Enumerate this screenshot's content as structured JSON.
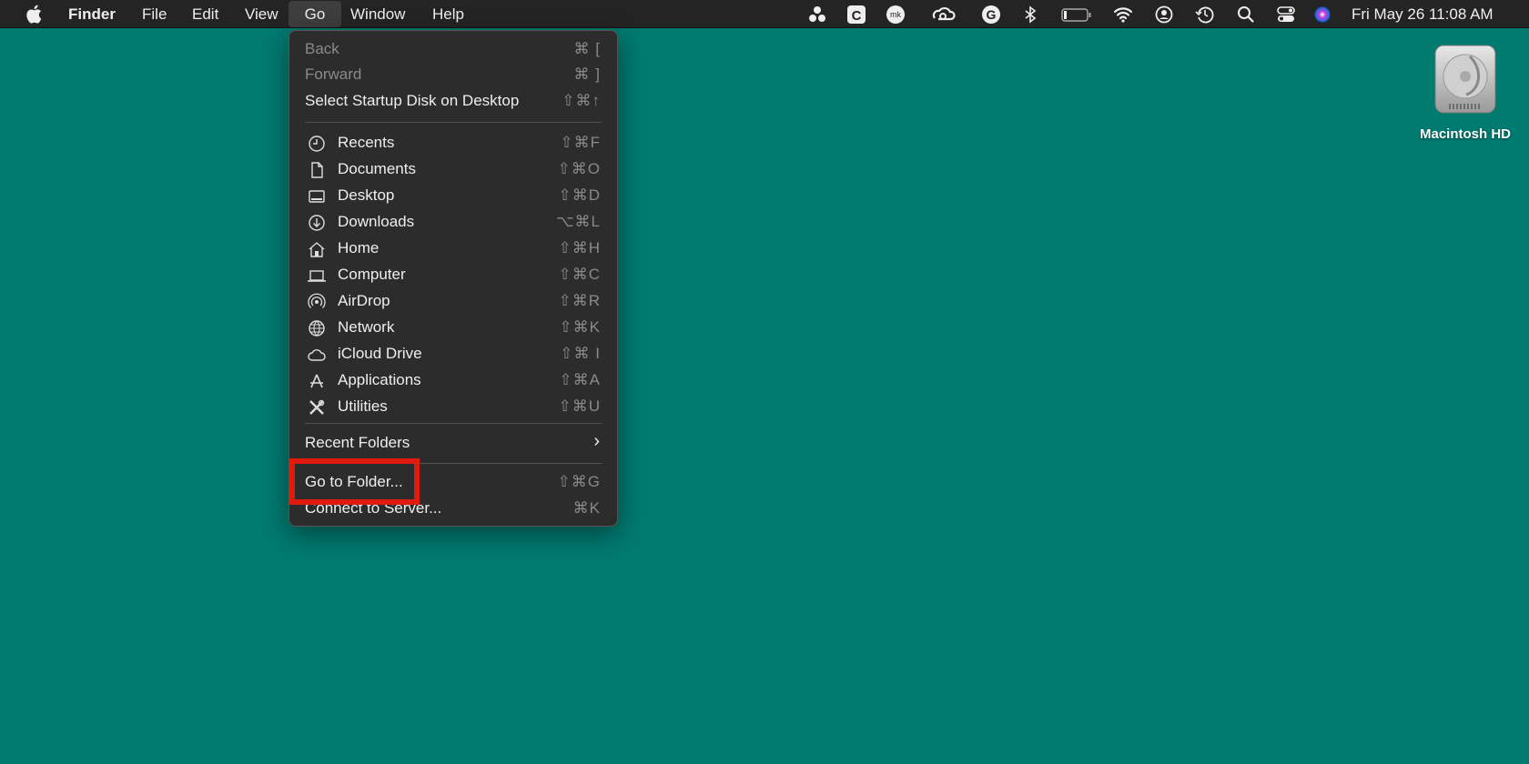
{
  "menubar": {
    "app_name": "Finder",
    "menus": [
      "File",
      "Edit",
      "View",
      "Go",
      "Window",
      "Help"
    ],
    "active_menu": "Go",
    "status_icons": [
      "asana-icon",
      "clipboard-c-icon",
      "mk-icon",
      "creative-cloud-icon",
      "grammarly-icon",
      "bluetooth-icon",
      "battery-icon",
      "wifi-icon",
      "user-icon",
      "time-machine-icon",
      "search-icon",
      "control-center-icon",
      "siri-icon"
    ],
    "clock": "Fri May 26  11:08 AM"
  },
  "go_menu": {
    "top_items": [
      {
        "label": "Back",
        "shortcut": "⌘ [",
        "disabled": true
      },
      {
        "label": "Forward",
        "shortcut": "⌘ ]",
        "disabled": true
      },
      {
        "label": "Select Startup Disk on Desktop",
        "shortcut": "⇧⌘↑",
        "disabled": false
      }
    ],
    "places": [
      {
        "label": "Recents",
        "shortcut": "⇧⌘F",
        "icon": "clock-icon"
      },
      {
        "label": "Documents",
        "shortcut": "⇧⌘O",
        "icon": "document-icon"
      },
      {
        "label": "Desktop",
        "shortcut": "⇧⌘D",
        "icon": "desktop-icon"
      },
      {
        "label": "Downloads",
        "shortcut": "⌥⌘L",
        "icon": "download-icon"
      },
      {
        "label": "Home",
        "shortcut": "⇧⌘H",
        "icon": "home-icon"
      },
      {
        "label": "Computer",
        "shortcut": "⇧⌘C",
        "icon": "laptop-icon"
      },
      {
        "label": "AirDrop",
        "shortcut": "⇧⌘R",
        "icon": "airdrop-icon"
      },
      {
        "label": "Network",
        "shortcut": "⇧⌘K",
        "icon": "globe-icon"
      },
      {
        "label": "iCloud Drive",
        "shortcut": "⇧⌘ I",
        "icon": "cloud-icon"
      },
      {
        "label": "Applications",
        "shortcut": "⇧⌘A",
        "icon": "applications-icon"
      },
      {
        "label": "Utilities",
        "shortcut": "⇧⌘U",
        "icon": "tools-icon"
      }
    ],
    "recent_folders": {
      "label": "Recent Folders",
      "submenu_glyph": "›"
    },
    "bottom_items": [
      {
        "label": "Go to Folder...",
        "shortcut": "⇧⌘G"
      },
      {
        "label": "Connect to Server...",
        "shortcut": "⌘K"
      }
    ]
  },
  "desktop": {
    "background_color": "#017a70",
    "icons": [
      {
        "label": "Macintosh HD",
        "icon": "hard-drive-icon"
      }
    ]
  },
  "highlight_color": "#e01a0e"
}
